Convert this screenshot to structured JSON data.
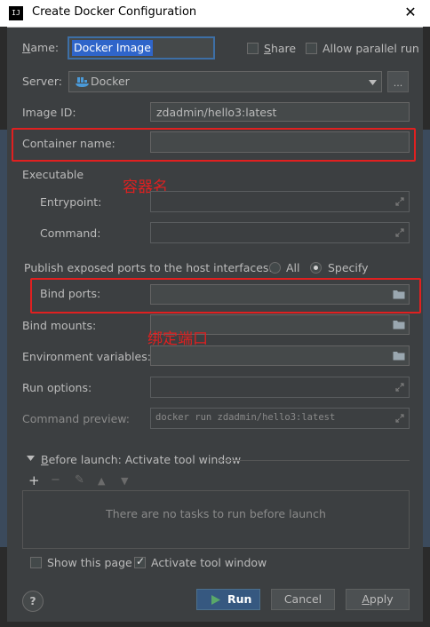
{
  "window": {
    "app_icon": "IJ",
    "title": "Create Docker Configuration",
    "close_glyph": "✕"
  },
  "name": {
    "label_prefix": "",
    "label_underlined": "N",
    "label_rest": "ame:",
    "value": "Docker Image"
  },
  "share": {
    "label_prefix": "",
    "label_underlined": "S",
    "label_rest": "hare",
    "checked": false
  },
  "parallel": {
    "label": "Allow parallel run",
    "checked": false
  },
  "server": {
    "label": "Server:",
    "value": "Docker",
    "icon": "docker-whale-icon",
    "more_label": "..."
  },
  "image_id": {
    "label": "Image ID:",
    "value": "zdadmin/hello3:latest"
  },
  "container_name": {
    "label": "Container name:",
    "value": ""
  },
  "executable": {
    "section_label": "Executable",
    "entrypoint_label": "Entrypoint:",
    "command_label": "Command:"
  },
  "publish": {
    "label": "Publish exposed ports to the host interfaces:",
    "option_all": "All",
    "option_specify": "Specify",
    "selected": "Specify"
  },
  "bind_ports": {
    "label": "Bind ports:",
    "value": ""
  },
  "bind_mounts": {
    "label": "Bind mounts:",
    "value": ""
  },
  "env_vars": {
    "label": "Environment variables:",
    "value": ""
  },
  "run_options": {
    "label": "Run options:",
    "value": ""
  },
  "command_preview": {
    "label": "Command preview:",
    "value": "docker run zdadmin/hello3:latest"
  },
  "annotations": {
    "container_name_note": "容器名",
    "bind_ports_note": "绑定端口",
    "color": "#e02020"
  },
  "before_launch": {
    "label_underlined": "B",
    "label_rest": "efore launch: Activate tool window",
    "empty_text": "There are no tasks to run before launch",
    "toolbar": [
      "add-icon",
      "remove-icon",
      "edit-icon",
      "move-up-icon",
      "move-down-icon"
    ],
    "add_glyph": "+",
    "remove_glyph": "−",
    "edit_glyph": "✎",
    "up_glyph": "▲",
    "down_glyph": "▼"
  },
  "show_page": {
    "label": "Show this page",
    "checked": false
  },
  "activate_tool_window": {
    "label": "Activate tool window",
    "checked": true
  },
  "buttons": {
    "help": "?",
    "run": "Run",
    "cancel": "Cancel",
    "apply_underlined": "A",
    "apply_rest": "pply"
  },
  "colors": {
    "background": "#3c3f41",
    "field": "#45494a",
    "default_button": "#365880",
    "run_icon": "#59a869",
    "selection": "#2f65ca",
    "annotation": "#e02020"
  }
}
